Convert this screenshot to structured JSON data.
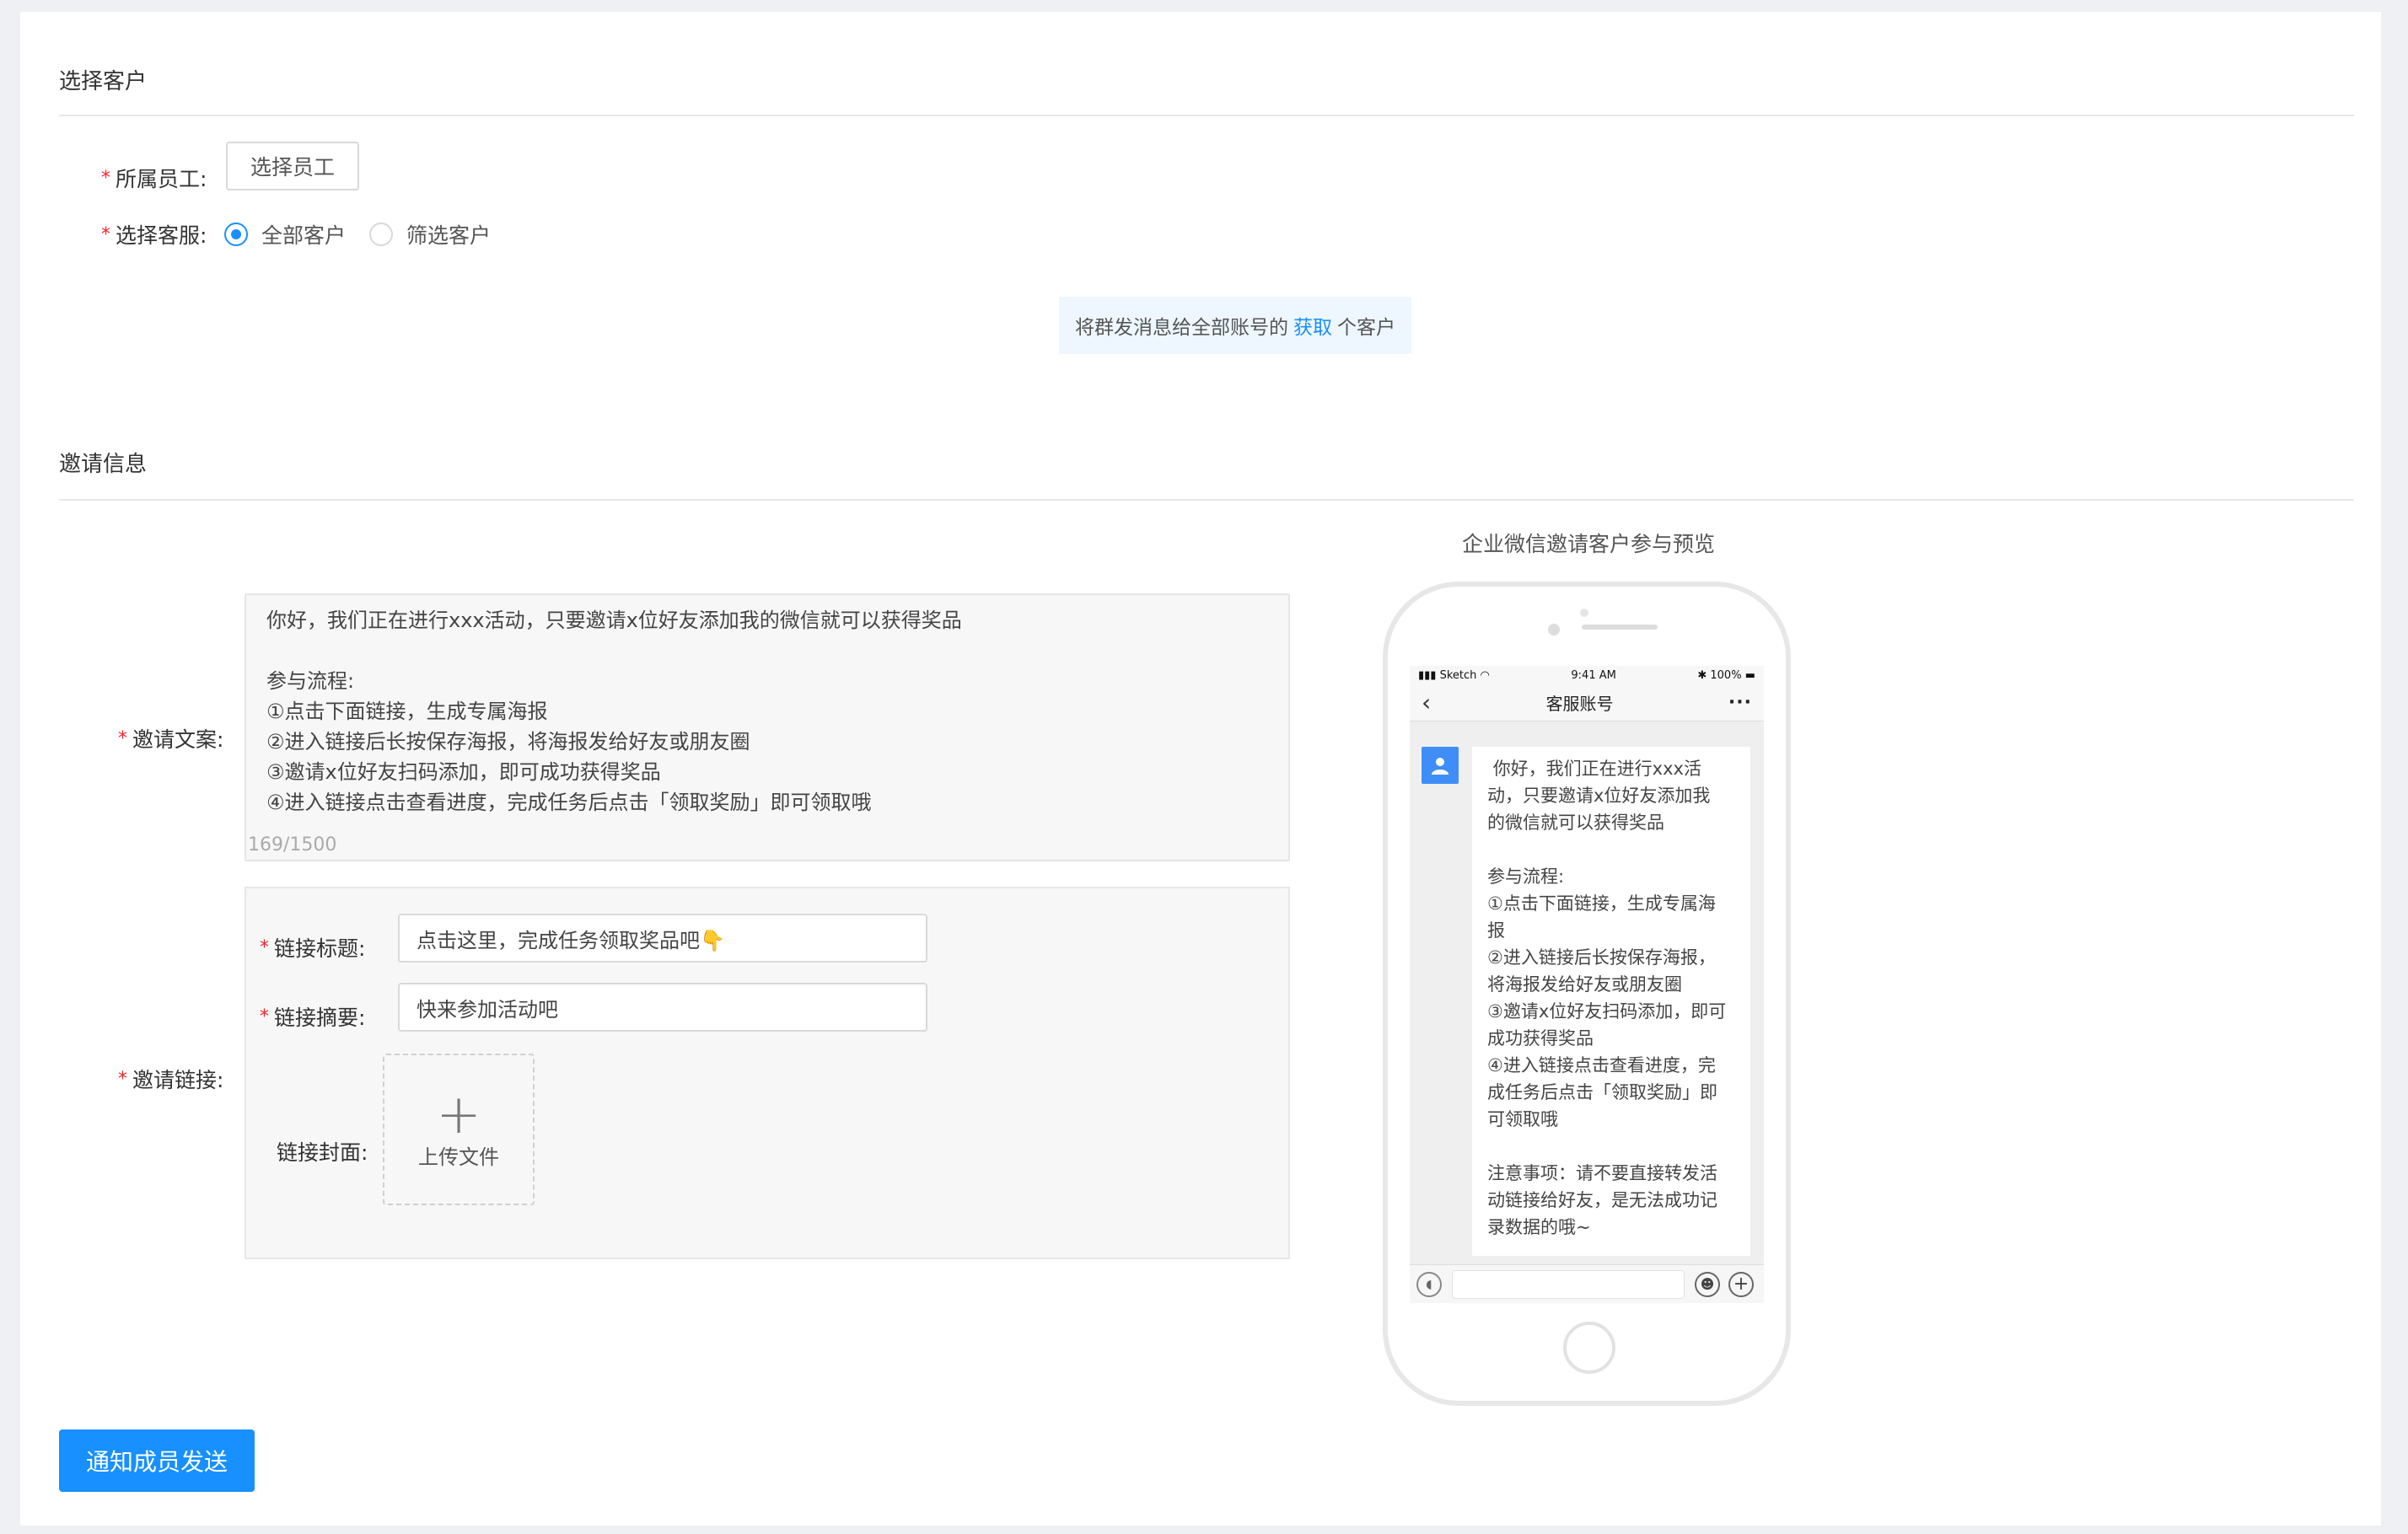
{
  "section1": {
    "title": "选择客户",
    "staff": {
      "label": "所属员工:",
      "button": "选择员工"
    },
    "service": {
      "label": "选择客服:",
      "options": [
        {
          "label": "全部客户",
          "selected": true
        },
        {
          "label": "筛选客户",
          "selected": false
        }
      ]
    },
    "notice": {
      "before": "将群发消息给全部账号的",
      "link": "获取",
      "after": "个客户"
    }
  },
  "section2": {
    "title": "邀请信息",
    "copy": {
      "label": "邀请文案:",
      "text": "你好，我们正在进行xxx活动，只要邀请x位好友添加我的微信就可以获得奖品\n\n参与流程:\n①点击下面链接，生成专属海报\n②进入链接后长按保存海报，将海报发给好友或朋友圈\n③邀请x位好友扫码添加，即可成功获得奖品\n④进入链接点击查看进度，完成任务后点击「领取奖励」即可领取哦",
      "counter": "169/1500"
    },
    "link": {
      "label": "邀请链接:",
      "title_label": "链接标题:",
      "title_value": "点击这里，完成任务领取奖品吧👇",
      "summary_label": "链接摘要:",
      "summary_value": "快来参加活动吧",
      "cover_label": "链接封面:",
      "upload_label": "上传文件"
    }
  },
  "preview": {
    "title": "企业微信邀请客户参与预览",
    "status_left": "Sketch",
    "status_time": "9:41 AM",
    "status_right": "100%",
    "nav_title": "客服账号",
    "message": " 你好，我们正在进行xxx活\n动，只要邀请x位好友添加我\n的微信就可以获得奖品\n\n参与流程:\n①点击下面链接，生成专属海\n报\n②进入链接后长按保存海报，\n将海报发给好友或朋友圈\n③邀请x位好友扫码添加，即可\n成功获得奖品\n④进入链接点击查看进度，完\n成任务后点击「领取奖励」即\n可领取哦\n\n注意事项：请不要直接转发活\n动链接给好友，是无法成功记\n录数据的哦~"
  },
  "submit": {
    "label": "通知成员发送"
  },
  "colors": {
    "primary": "#1890ff",
    "required": "#f5222d",
    "notice_bg": "#eef7ff"
  }
}
